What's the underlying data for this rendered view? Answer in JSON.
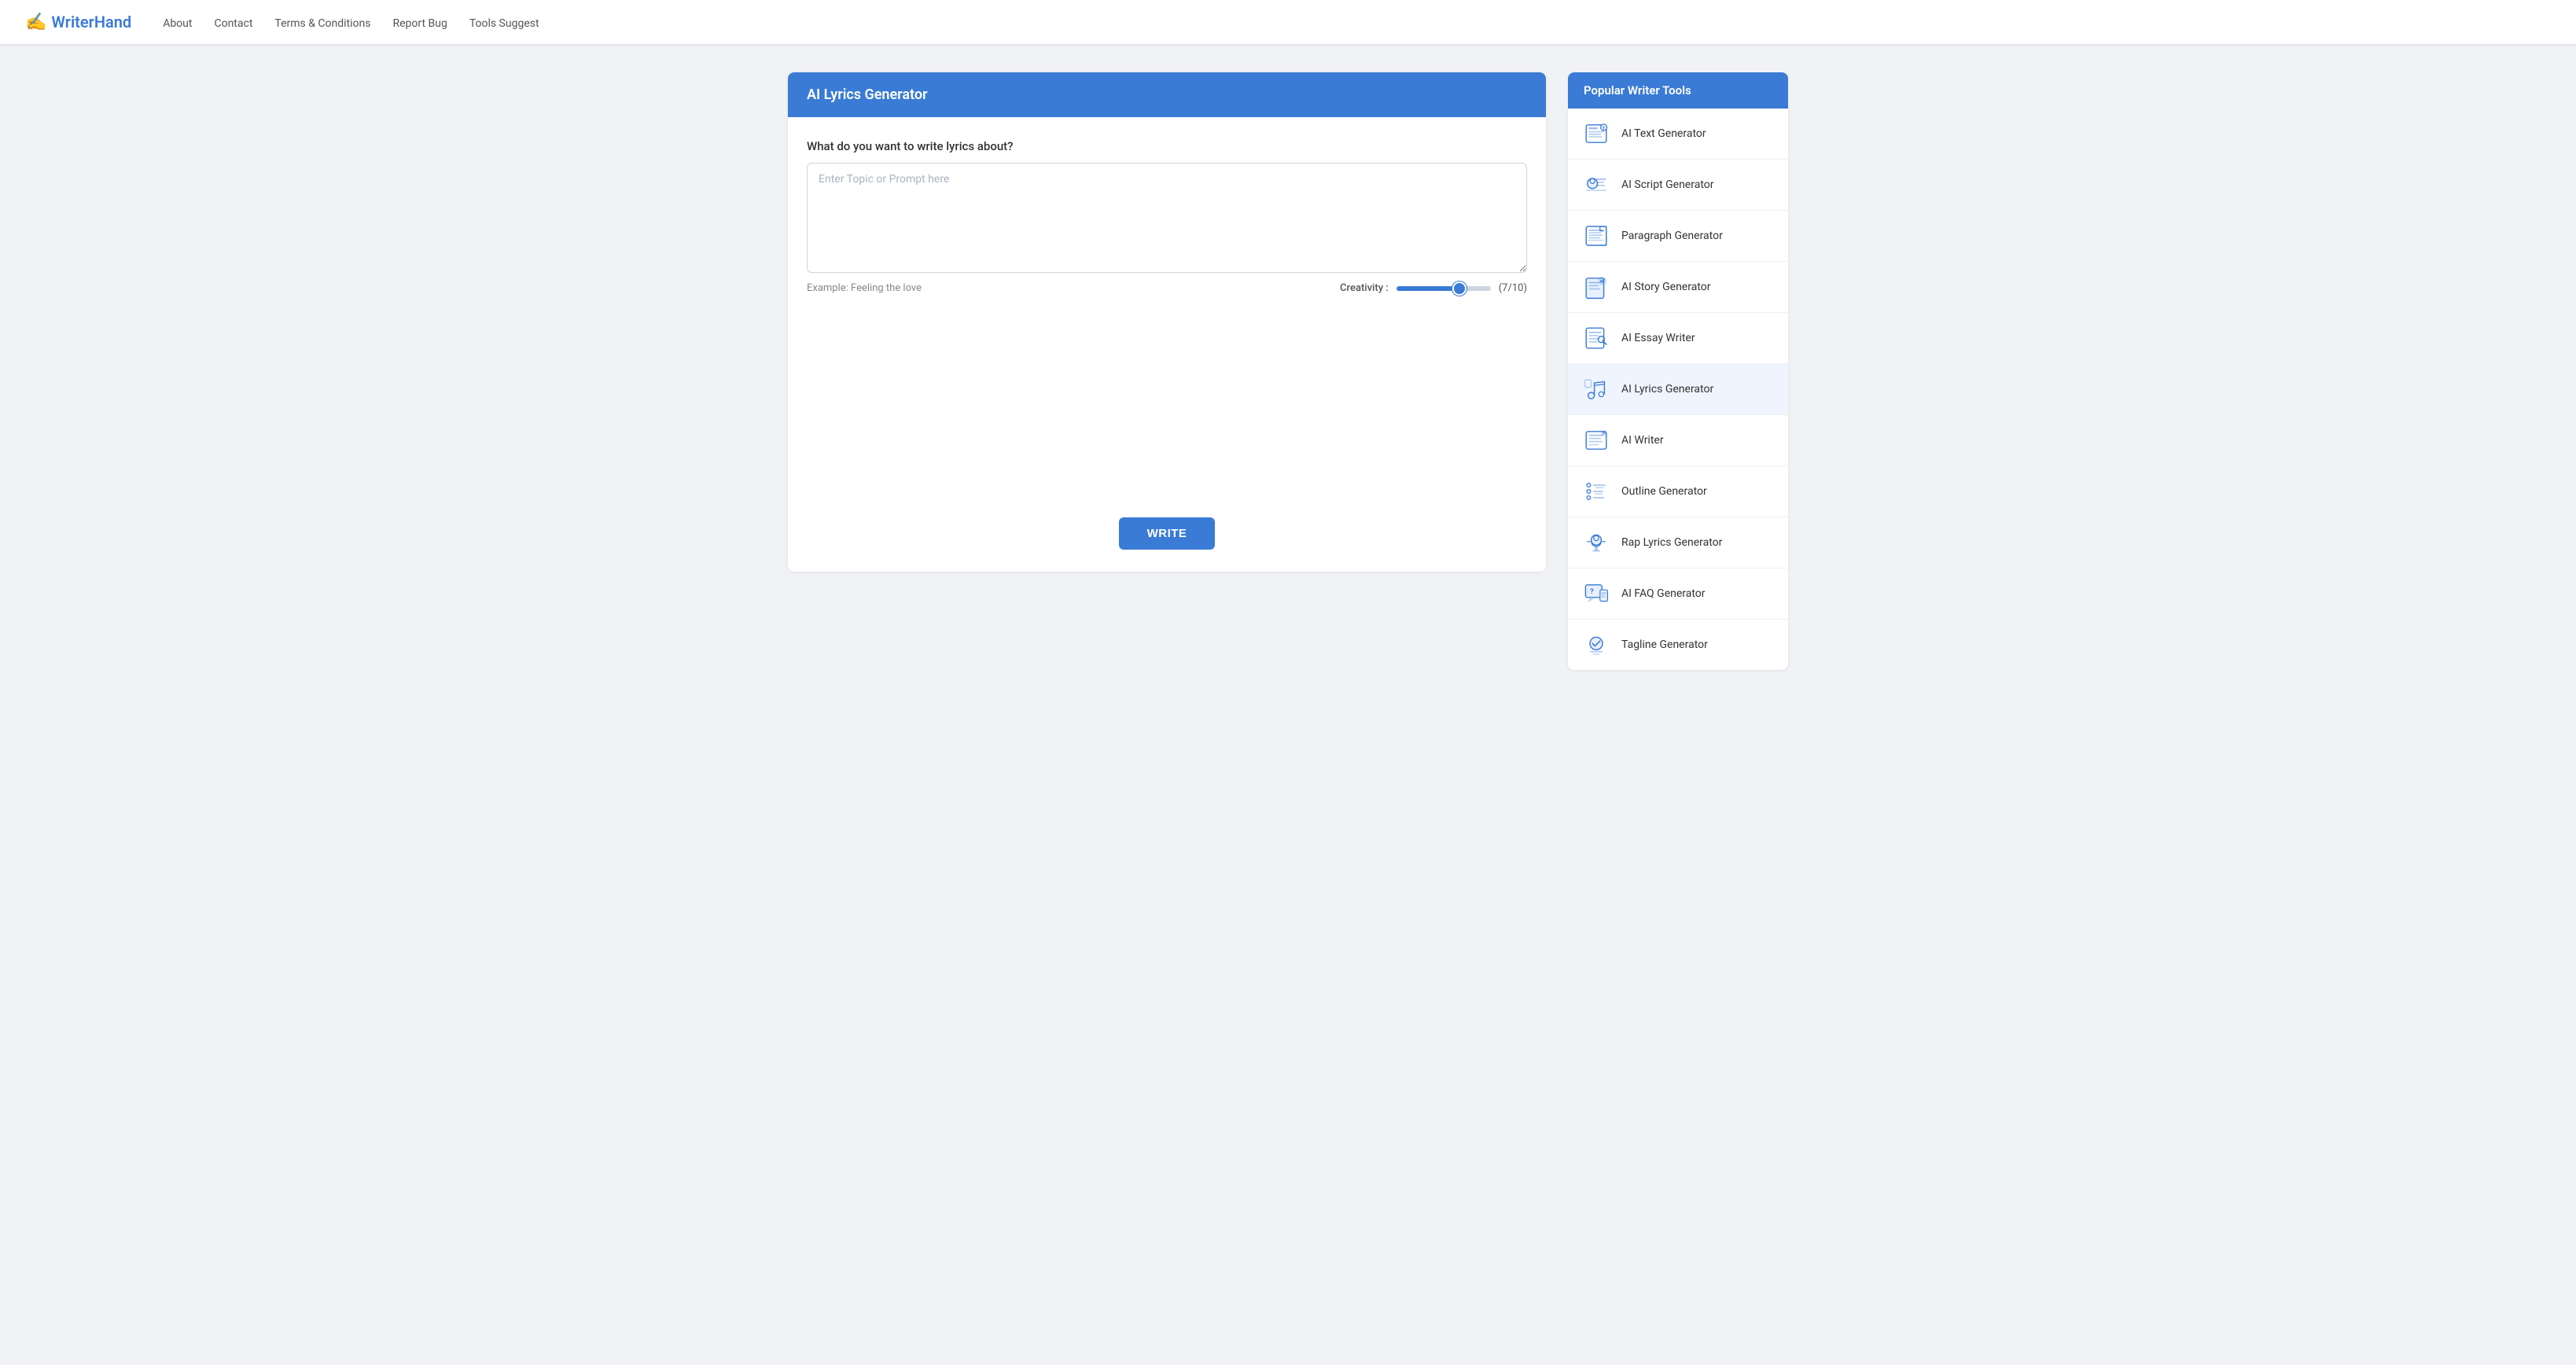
{
  "brand": {
    "name_part1": "Writer",
    "name_part2": "Hand",
    "logo_icon": "✍"
  },
  "nav": {
    "links": [
      {
        "label": "About",
        "href": "#"
      },
      {
        "label": "Contact",
        "href": "#"
      },
      {
        "label": "Terms & Conditions",
        "href": "#"
      },
      {
        "label": "Report Bug",
        "href": "#"
      },
      {
        "label": "Tools Suggest",
        "href": "#"
      }
    ]
  },
  "main": {
    "header_title": "AI Lyrics Generator",
    "field_label": "What do you want to write lyrics about?",
    "textarea_placeholder": "Enter Topic or Prompt here",
    "example_text": "Example: Feeling the love",
    "creativity_label": "Creativity :",
    "creativity_value": "(7/10)",
    "creativity_min": 0,
    "creativity_max": 10,
    "creativity_current": 7,
    "write_button_label": "WRITE"
  },
  "sidebar": {
    "header_title": "Popular Writer Tools",
    "items": [
      {
        "id": "text-gen",
        "label": "AI Text Generator",
        "icon": "text"
      },
      {
        "id": "script-gen",
        "label": "AI Script Generator",
        "icon": "script"
      },
      {
        "id": "paragraph-gen",
        "label": "Paragraph Generator",
        "icon": "paragraph"
      },
      {
        "id": "story-gen",
        "label": "AI Story Generator",
        "icon": "story"
      },
      {
        "id": "essay-writer",
        "label": "AI Essay Writer",
        "icon": "essay"
      },
      {
        "id": "lyrics-gen",
        "label": "AI Lyrics Generator",
        "icon": "lyrics"
      },
      {
        "id": "ai-writer",
        "label": "AI Writer",
        "icon": "writer"
      },
      {
        "id": "outline-gen",
        "label": "Outline Generator",
        "icon": "outline"
      },
      {
        "id": "rap-gen",
        "label": "Rap Lyrics Generator",
        "icon": "rap"
      },
      {
        "id": "faq-gen",
        "label": "AI FAQ Generator",
        "icon": "faq"
      },
      {
        "id": "tagline-gen",
        "label": "Tagline Generator",
        "icon": "tagline"
      }
    ]
  }
}
